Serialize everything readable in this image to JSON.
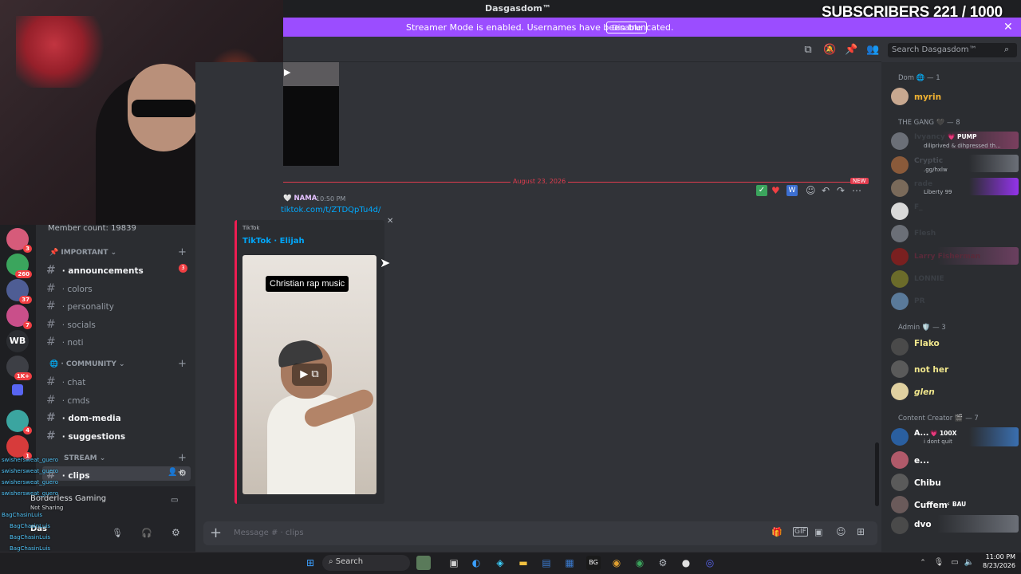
{
  "window": {
    "title": "Dasgasdom™"
  },
  "overlay": {
    "subscribers": "SUBSCRIBERS 221 / 1000"
  },
  "streamer_bar": {
    "text": "Streamer Mode is enabled. Usernames have been truncated.",
    "button": "Disable"
  },
  "header": {
    "search_placeholder": "Search Dasgasdom™"
  },
  "server": {
    "member_count": "Member count: 19839"
  },
  "servers": [
    {
      "label": "",
      "badge": "3",
      "color": "#d65b7a"
    },
    {
      "label": "",
      "badge": "260",
      "color": "#3ba55d"
    },
    {
      "label": "",
      "badge": "37",
      "color": "#4e5d94"
    },
    {
      "label": "",
      "badge": "7",
      "color": "#c94f8a"
    },
    {
      "label": "WB",
      "badge": "",
      "color": "#2b2d31"
    },
    {
      "label": "",
      "badge": "1K+",
      "color": "#3d3f45"
    },
    {
      "label": "",
      "badge": "",
      "color": "#5865f2"
    },
    {
      "label": "",
      "badge": "4",
      "color": "#3ba5a0"
    },
    {
      "label": "",
      "badge": "1",
      "color": "#d73b3b"
    }
  ],
  "categories": {
    "important": "IMPORTANT",
    "community": "COMMUNITY",
    "stream": "STREAM"
  },
  "channels": {
    "announcements": "announcements",
    "announcements_badge": "3",
    "colors": "colors",
    "personality": "personality",
    "socials": "socials",
    "noti": "noti",
    "chat": "chat",
    "cmds": "cmds",
    "dom_media": "dom-media",
    "suggestions": "suggestions",
    "clips": "clips"
  },
  "voice": {
    "activity": "Borderless Gaming"
  },
  "user": {
    "name": "Das"
  },
  "chat": {
    "divider_date": "August 23, 2026",
    "new_label": "NEW",
    "author": "NAMA",
    "time": "10:50 PM",
    "link": "tiktok.com/t/ZTDQpTu4d/",
    "embed_provider": "TikTok",
    "embed_title": "TikTok · Elijah",
    "video_caption": "Christian rap music",
    "composer_placeholder": "Message # · clips"
  },
  "members": {
    "role_dom": "Dom 🌐 — 1",
    "role_gang": "THE GANG 🖤 — 8",
    "role_admin": "Admin 🛡️ — 3",
    "role_creator": "Content Creator 🎬 — 7",
    "dom": [
      {
        "name": "myrin",
        "color": "#f0b232"
      }
    ],
    "gang": [
      {
        "name": "Ivyancy",
        "sub": "diliprived & dihpressed th...",
        "tag": "PUMP",
        "color": "#3b3f45"
      },
      {
        "name": "Cryptic",
        "sub": ".gg/hxlw",
        "color": "#3b3f45"
      },
      {
        "name": "rade",
        "sub": "Liberty 99",
        "color": "#3b3f45"
      },
      {
        "name": "F_",
        "sub": "",
        "color": "#3b3f45"
      },
      {
        "name": "Flesh",
        "sub": "",
        "color": "#3b3f45"
      },
      {
        "name": "Larry Fisherman",
        "sub": "",
        "color": "#4a3f4a"
      },
      {
        "name": "LONNIE",
        "sub": "",
        "color": "#3b3f45"
      },
      {
        "name": "PR",
        "sub": "",
        "color": "#3b3f45"
      }
    ],
    "admin": [
      {
        "name": "Flako",
        "color": "#f0e68c"
      },
      {
        "name": "not her",
        "color": "#f0e68c"
      },
      {
        "name": "glen",
        "color": "#f0e68c"
      }
    ],
    "creator": [
      {
        "name": "A...",
        "tag": "100X",
        "sub": "i dont quit",
        "color": "#ffffff"
      },
      {
        "name": "e...",
        "color": "#ffffff"
      },
      {
        "name": "Chibu",
        "color": "#ffffff"
      },
      {
        "name": "Cuffem",
        "tag": "BAU",
        "color": "#ffffff"
      },
      {
        "name": "dvo",
        "color": "#ffffff"
      }
    ]
  },
  "chat_overlay": [
    "swishersweat_guero",
    "swishersweat_guero",
    "swishersweat_guero",
    "swishersweat_guero",
    "Not Sharing",
    "BagChasinLuis",
    "BagChasinLuis",
    "BagChasinLuis",
    "BagChasinLuis"
  ],
  "taskbar": {
    "search": "Search",
    "time": "11:00 PM",
    "date": "8/23/2026"
  }
}
